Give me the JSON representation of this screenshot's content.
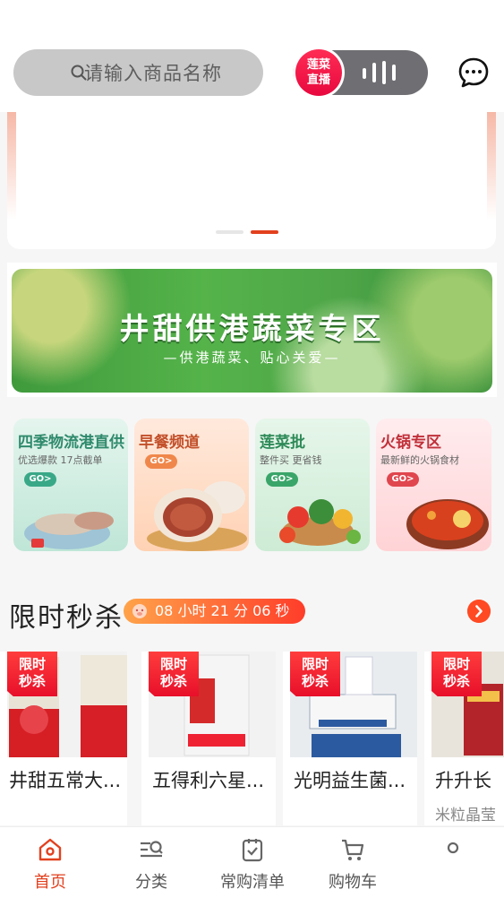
{
  "search": {
    "placeholder": "请输入商品名称"
  },
  "live": {
    "badge": "莲菜\n直播",
    "badge_line1": "莲菜",
    "badge_line2": "直播"
  },
  "carousel": {
    "slides": 2,
    "active_index": 1
  },
  "banner": {
    "title": "井甜供港蔬菜专区",
    "subtitle": "—供港蔬菜、贴心关爱—"
  },
  "categories": [
    {
      "title": "四季物流港直供",
      "sub": "优选爆款 17点截单",
      "go": "GO>",
      "title_color": "#2f8a6c",
      "go_color": "#39a887"
    },
    {
      "title": "早餐频道",
      "sub": "",
      "go": "GO>",
      "title_color": "#c2502a",
      "go_color": "#f0874a"
    },
    {
      "title": "莲菜批",
      "sub": "整件买 更省钱",
      "go": "GO>",
      "title_color": "#2e8a58",
      "go_color": "#3aa569"
    },
    {
      "title": "火锅专区",
      "sub": "最新鲜的火锅食材",
      "go": "GO>",
      "title_color": "#c0303a",
      "go_color": "#e0464e"
    }
  ],
  "flash_sale": {
    "title": "限时秒杀",
    "timer": "08 小时 21 分 06 秒"
  },
  "products": [
    {
      "tag_line1": "限时",
      "tag_line2": "秒杀",
      "name": "井甜五常大...",
      "sub": ""
    },
    {
      "tag_line1": "限时",
      "tag_line2": "秒杀",
      "name": "五得利六星...",
      "sub": ""
    },
    {
      "tag_line1": "限时",
      "tag_line2": "秒杀",
      "name": "光明益生菌...",
      "sub": ""
    },
    {
      "tag_line1": "限时",
      "tag_line2": "秒杀",
      "name": "升升长",
      "sub": "米粒晶莹"
    }
  ],
  "tabbar": [
    {
      "label": "首页",
      "icon": "home-icon",
      "active": true
    },
    {
      "label": "分类",
      "icon": "category-icon",
      "active": false
    },
    {
      "label": "常购清单",
      "icon": "list-icon",
      "active": false
    },
    {
      "label": "购物车",
      "icon": "cart-icon",
      "active": false
    },
    {
      "label": "",
      "icon": "profile-icon",
      "active": false
    }
  ],
  "colors": {
    "accent": "#e2401e",
    "live_red": "#ff2d55",
    "timer_start": "#ffa34a",
    "timer_end": "#ff3d2a"
  }
}
